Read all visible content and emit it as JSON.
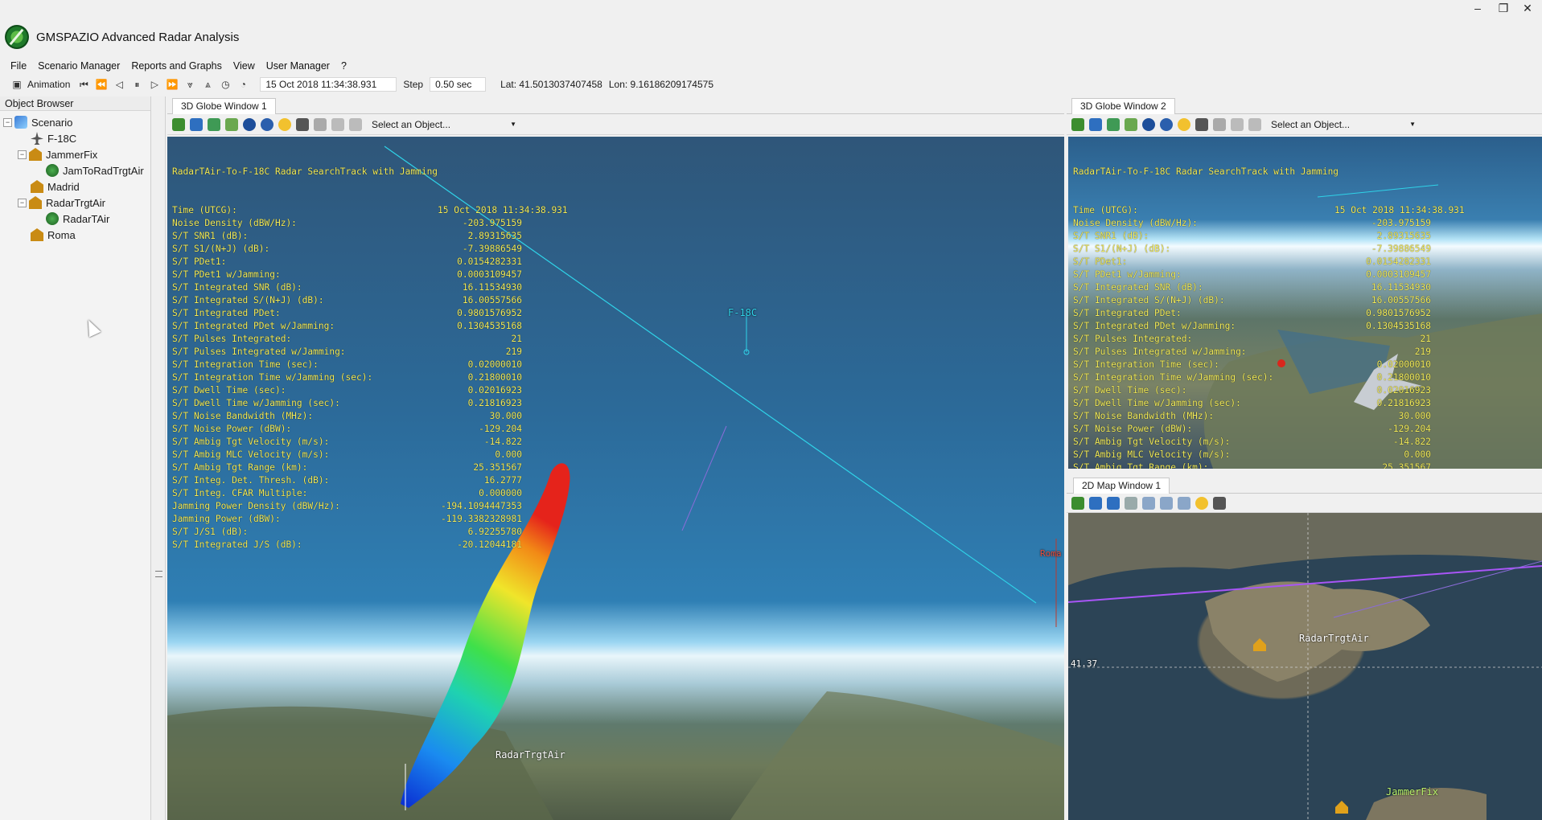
{
  "app": {
    "title": "GMSPAZIO Advanced Radar Analysis",
    "minimize": "–",
    "maximize": "❐",
    "close": "✕"
  },
  "menu": [
    "File",
    "Scenario Manager",
    "Reports and Graphs",
    "View",
    "User Manager",
    "?"
  ],
  "animation": {
    "label": "Animation",
    "datetime": "15 Oct 2018 11:34:38.931",
    "step_label": "Step",
    "step_value": "0.50 sec",
    "lat": "Lat: 41.5013037407458",
    "lon": "Lon: 9.16186209174575"
  },
  "browser": {
    "title": "Object Browser",
    "items": [
      {
        "label": "Scenario",
        "icon": "scenario-icon",
        "expanded": true
      },
      {
        "label": "F-18C",
        "icon": "aircraft-icon"
      },
      {
        "label": "JammerFix",
        "icon": "facility-icon",
        "expanded": true
      },
      {
        "label": "JamToRadTrgtAir",
        "icon": "sensor-icon"
      },
      {
        "label": "Madrid",
        "icon": "facility-icon"
      },
      {
        "label": "RadarTrgtAir",
        "icon": "facility-icon",
        "expanded": true
      },
      {
        "label": "RadarTAir",
        "icon": "sensor-icon"
      },
      {
        "label": "Roma",
        "icon": "facility-icon"
      }
    ]
  },
  "globe1": {
    "tab": "3D Globe Window 1",
    "select": "Select an Object..."
  },
  "globe2": {
    "tab": "3D Globe Window 2",
    "select": "Select an Object..."
  },
  "map": {
    "tab": "2D Map Window 1",
    "lat_tick": "41.37",
    "label_radar": "RadarTrgtAir",
    "label_jammer": "JammerFix"
  },
  "overlay": {
    "title": "RadarTAir-To-F-18C Radar SearchTrack with Jamming",
    "rows": [
      {
        "label": "Time (UTCG):",
        "value": "15 Oct 2018 11:34:38.931"
      },
      {
        "label": "Noise Density (dBW/Hz):",
        "value": "-203.975159"
      },
      {
        "label": "S/T SNR1 (dB):",
        "value": "2.89315635"
      },
      {
        "label": "S/T S1/(N+J) (dB):",
        "value": "-7.39886549"
      },
      {
        "label": "S/T PDet1:",
        "value": "0.0154282331"
      },
      {
        "label": "S/T PDet1 w/Jamming:",
        "value": "0.0003109457"
      },
      {
        "label": "S/T Integrated SNR (dB):",
        "value": "16.11534930"
      },
      {
        "label": "S/T Integrated S/(N+J) (dB):",
        "value": "16.00557566"
      },
      {
        "label": "S/T Integrated PDet:",
        "value": "0.9801576952"
      },
      {
        "label": "S/T Integrated PDet w/Jamming:",
        "value": "0.1304535168"
      },
      {
        "label": "S/T Pulses Integrated:",
        "value": "21"
      },
      {
        "label": "S/T Pulses Integrated w/Jamming:",
        "value": "219"
      },
      {
        "label": "S/T Integration Time (sec):",
        "value": "0.02000010"
      },
      {
        "label": "S/T Integration Time w/Jamming (sec):",
        "value": "0.21800010"
      },
      {
        "label": "S/T Dwell Time (sec):",
        "value": "0.02016923"
      },
      {
        "label": "S/T Dwell Time w/Jamming (sec):",
        "value": "0.21816923"
      },
      {
        "label": "S/T Noise Bandwidth (MHz):",
        "value": "30.000"
      },
      {
        "label": "S/T Noise Power (dBW):",
        "value": "-129.204"
      },
      {
        "label": "S/T Ambig Tgt Velocity (m/s):",
        "value": "-14.822"
      },
      {
        "label": "S/T Ambig MLC Velocity (m/s):",
        "value": "0.000"
      },
      {
        "label": "S/T Ambig Tgt Range (km):",
        "value": "25.351567"
      },
      {
        "label": "S/T Integ. Det. Thresh. (dB):",
        "value": "16.2777"
      },
      {
        "label": "S/T Integ. CFAR Multiple:",
        "value": "0.000000"
      },
      {
        "label": "Jamming Power Density (dBW/Hz):",
        "value": "-194.1094447353"
      },
      {
        "label": "Jamming Power (dBW):",
        "value": "-119.3382328981"
      },
      {
        "label": "S/T J/S1 (dB):",
        "value": "6.92255780"
      },
      {
        "label": "S/T Integrated J/S (dB):",
        "value": "-20.12044181"
      }
    ]
  },
  "labels": {
    "f18": "F-18C",
    "radar": "RadarTrgtAir",
    "roma": "Roma"
  },
  "colors": {
    "overlay": "#f3ec5a",
    "track": "#2fd3e8",
    "map_track": "#a855f7"
  }
}
